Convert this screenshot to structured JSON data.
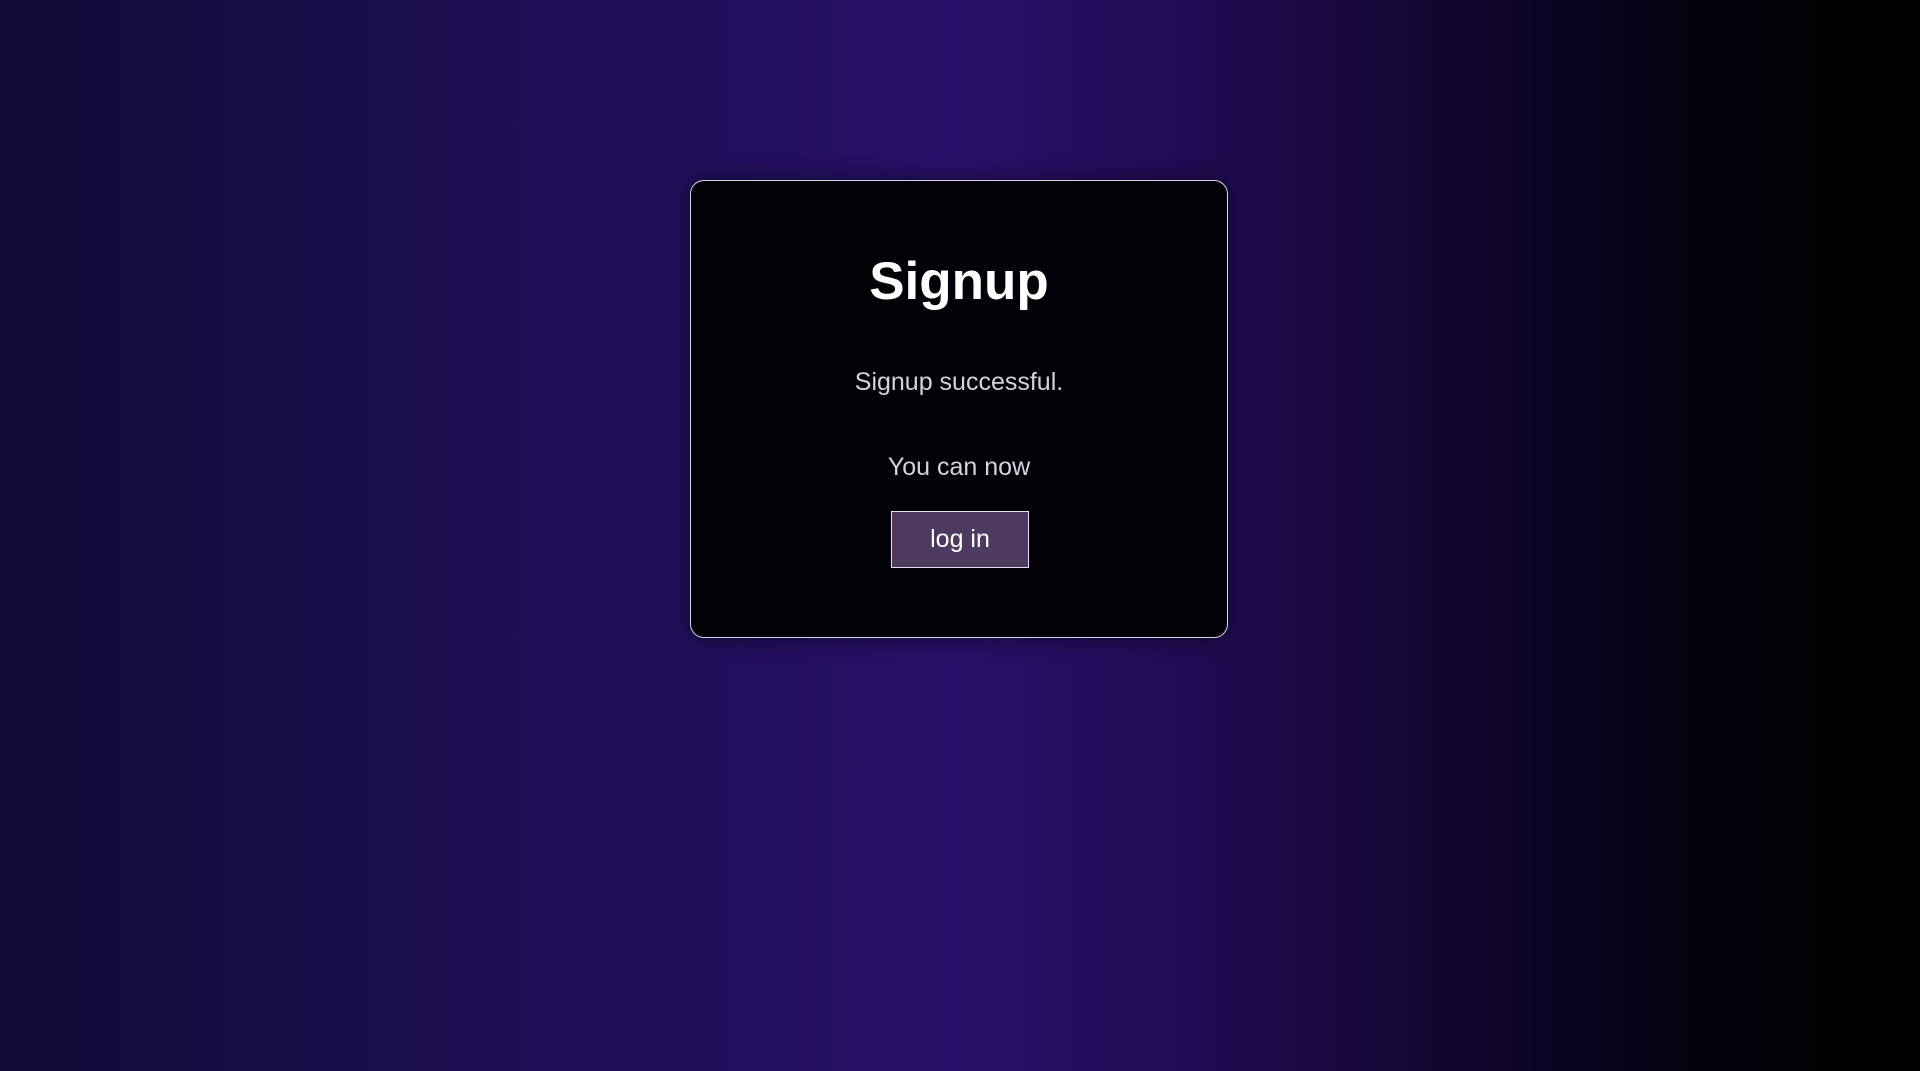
{
  "signup_card": {
    "title": "Signup",
    "message": "Signup successful.",
    "prompt": "You can now",
    "login_button_label": "log in"
  },
  "colors": {
    "card_background": "#020107",
    "card_border": "#d9d1e6",
    "button_background": "#4e3a5f",
    "title_text": "#ffffff",
    "body_text": "#d6d2dc",
    "page_gradient_center": "#28106a",
    "page_gradient_right": "#000000"
  }
}
